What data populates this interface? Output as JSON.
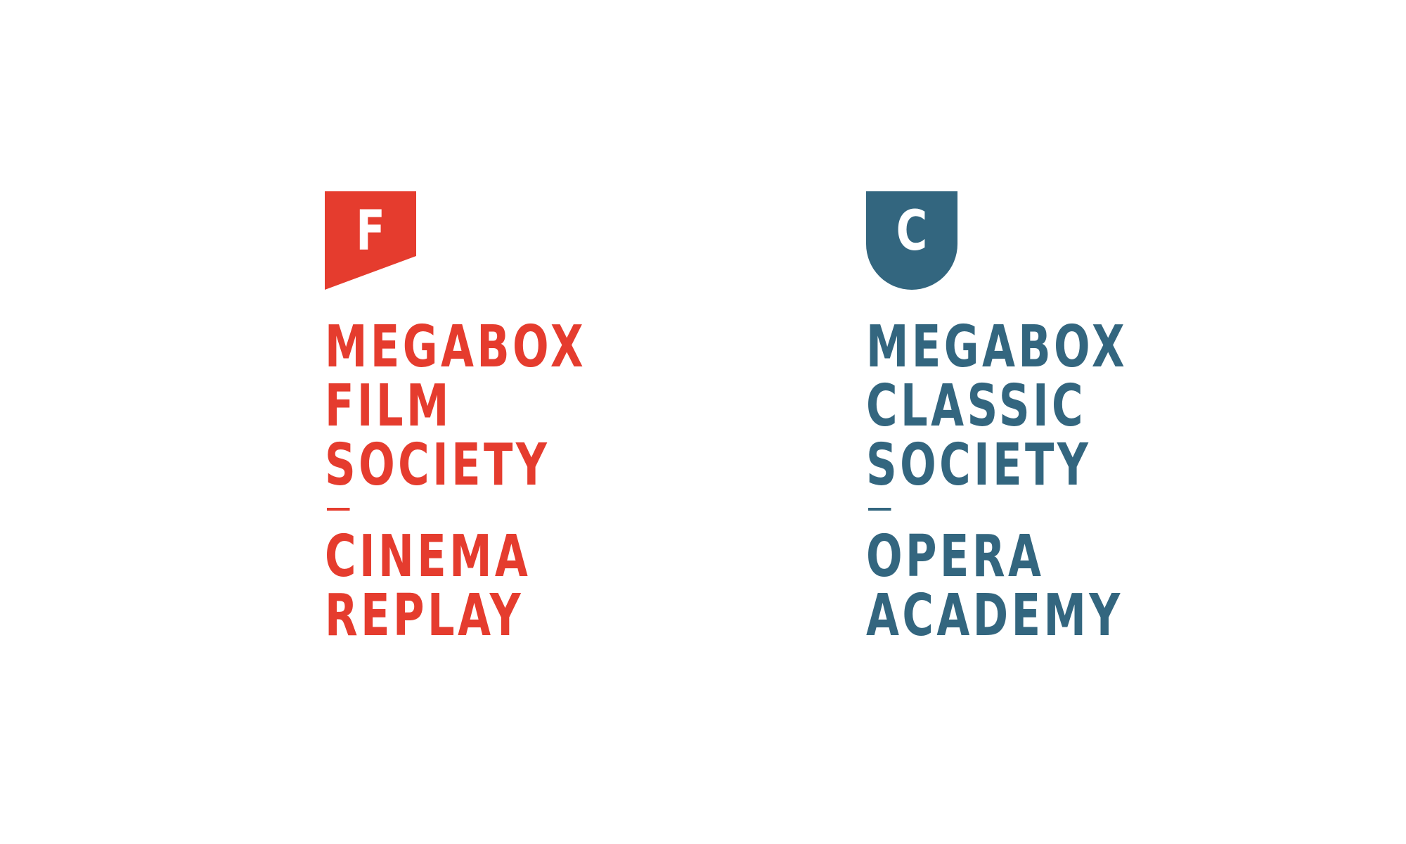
{
  "colors": {
    "film": "#e53c2e",
    "classic": "#33667f"
  },
  "film_logo": {
    "emblem_icon": "flag-banner-icon",
    "emblem_letter": "F",
    "lines": [
      "MEGABOX",
      "FILM",
      "SOCIETY"
    ],
    "sub_lines": [
      "CINEMA",
      "REPLAY"
    ]
  },
  "classic_logo": {
    "emblem_icon": "shield-badge-icon",
    "emblem_letter": "C",
    "lines": [
      "MEGABOX",
      "CLASSIC",
      "SOCIETY"
    ],
    "sub_lines": [
      "OPERA",
      "ACADEMY"
    ]
  }
}
